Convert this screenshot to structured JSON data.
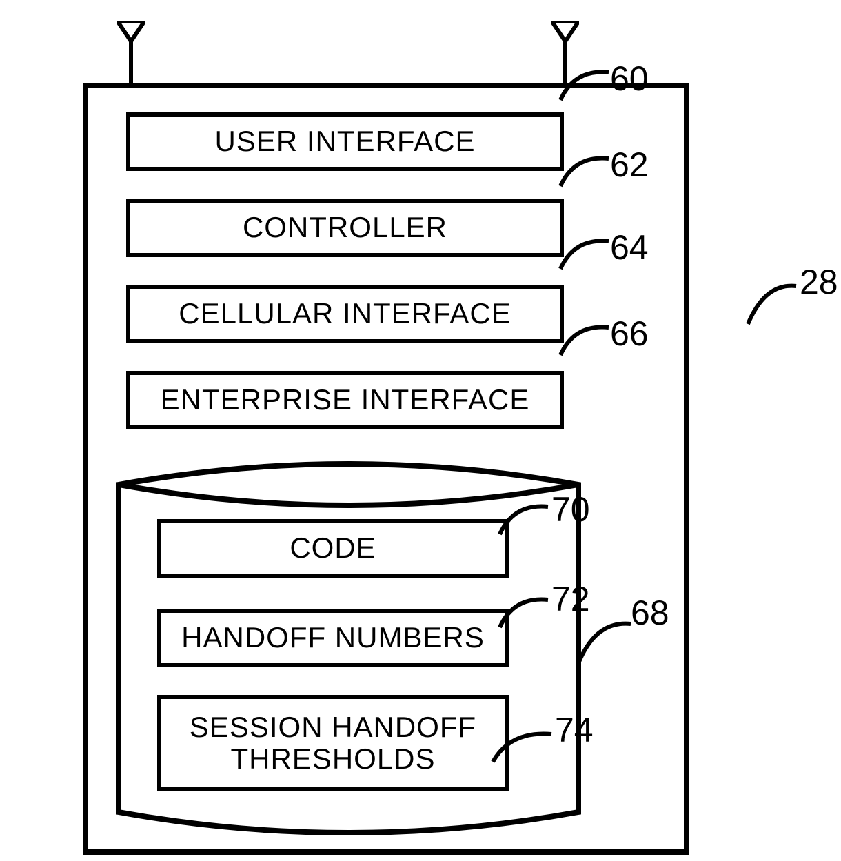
{
  "device": {
    "ref": "28",
    "blocks": {
      "user_interface": {
        "label": "USER INTERFACE",
        "ref": "60"
      },
      "controller": {
        "label": "CONTROLLER",
        "ref": "62"
      },
      "cellular_interface": {
        "label": "CELLULAR INTERFACE",
        "ref": "64"
      },
      "enterprise_interface": {
        "label": "ENTERPRISE INTERFACE",
        "ref": "66"
      }
    },
    "storage": {
      "ref": "68",
      "blocks": {
        "code": {
          "label": "CODE",
          "ref": "70"
        },
        "handoff_numbers": {
          "label": "HANDOFF NUMBERS",
          "ref": "72"
        },
        "session_handoff": {
          "label": "SESSION HANDOFF THRESHOLDS",
          "ref": "74"
        }
      }
    },
    "antennas": [
      "left",
      "right"
    ]
  }
}
